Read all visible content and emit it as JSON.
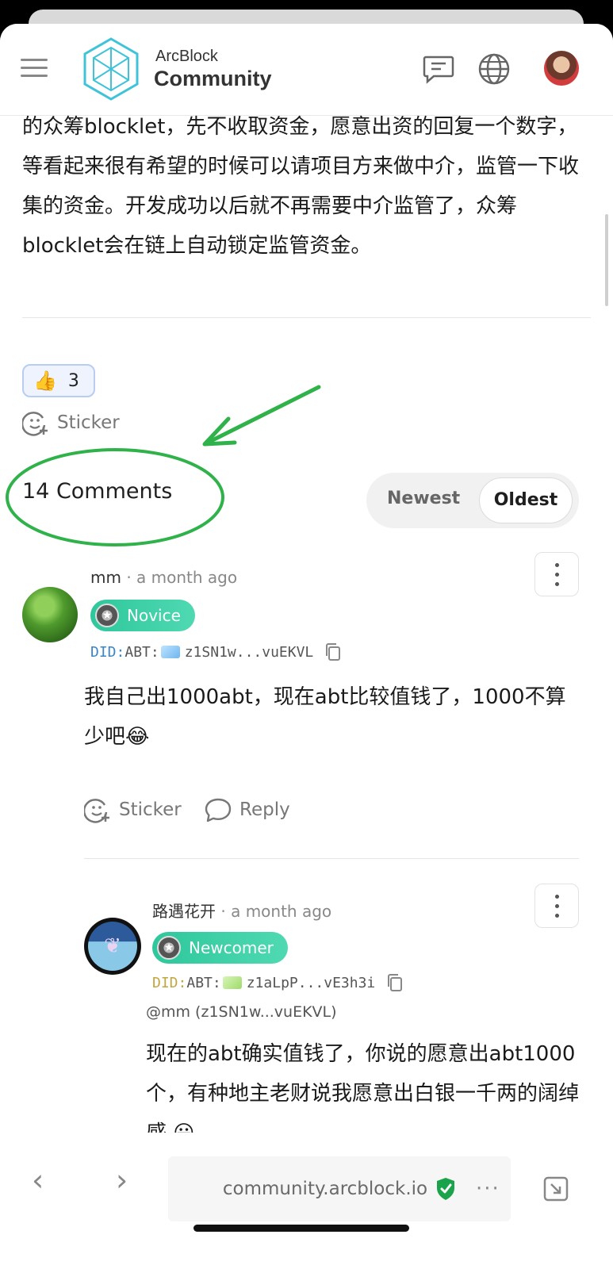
{
  "header": {
    "logo_top": "ArcBlock",
    "logo_bottom": "Community"
  },
  "post": {
    "text": "的众筹blocklet，先不收取资金，愿意出资的回复一个数字，等看起来很有希望的时候可以请项目方来做中介，监管一下收集的资金。开发成功以后就不再需要中介监管了，众筹blocklet会在链上自动锁定监管资金。",
    "reaction_emoji": "👍",
    "reaction_count": "3",
    "sticker_label": "Sticker"
  },
  "comments": {
    "title": "14 Comments",
    "sort_options": [
      "Newest",
      "Oldest"
    ],
    "selected_sort": "Oldest",
    "items": [
      {
        "author": "mm",
        "time": "· a month ago",
        "badge": "Novice",
        "did_prefix": "DID:",
        "did_type": "ABT:",
        "did_value": "z1SN1w...vuEKVL",
        "body": "我自己出1000abt，现在abt比较值钱了，1000不算少吧😂",
        "sticker_label": "Sticker",
        "reply_label": "Reply"
      },
      {
        "author": "路遇花开",
        "time": "· a month ago",
        "badge": "Newcomer",
        "did_prefix": "DID:",
        "did_type": "ABT:",
        "did_value": "z1aLpP...vE3h3i",
        "mention": "@mm (z1SN1w...vuEKVL)",
        "body": "现在的abt确实值钱了，你说的愿意出abt1000个，有种地主老财说我愿意出白银一千两的阔绰感 😀"
      }
    ]
  },
  "browser": {
    "url": "community.arcblock.io",
    "back": "‹",
    "forward": "›",
    "more": "···"
  },
  "colors": {
    "accent_green": "#2fb24a",
    "badge_teal": "#2ec79b",
    "did_blue": "#3a86c8",
    "secure_green": "#1aa34a"
  }
}
